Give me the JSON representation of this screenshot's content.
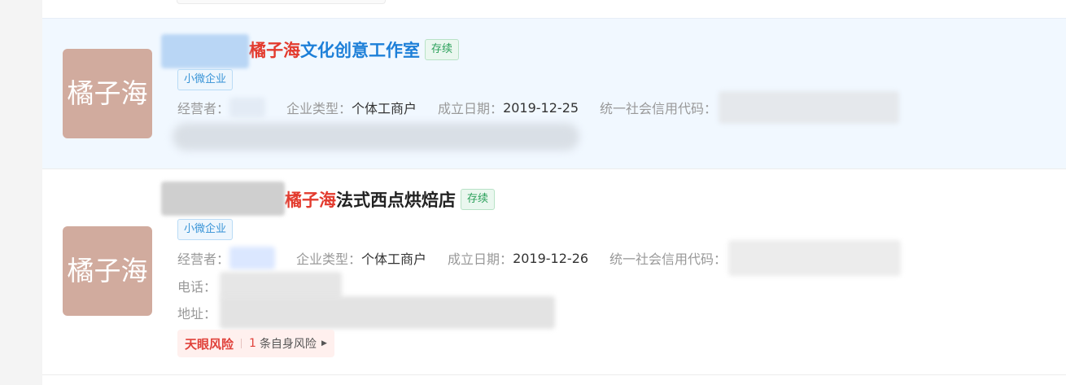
{
  "results": [
    {
      "logo_text": "橘子海",
      "title_highlight": "橘子海",
      "title_rest": "文化创意工作室",
      "status": "存续",
      "tag": "小微企业",
      "operator_label": "经营者：",
      "type_label": "企业类型：",
      "type_value": "个体工商户",
      "date_label": "成立日期：",
      "date_value": "2019-12-25",
      "credit_label": "统一社会信用代码："
    },
    {
      "logo_text": "橘子海",
      "title_highlight": "橘子海",
      "title_rest": "法式西点烘焙店",
      "status": "存续",
      "tag": "小微企业",
      "operator_label": "经营者：",
      "type_label": "企业类型：",
      "type_value": "个体工商户",
      "date_label": "成立日期：",
      "date_value": "2019-12-26",
      "credit_label": "统一社会信用代码：",
      "phone_label": "电话：",
      "address_label": "地址：",
      "risk": {
        "brand": "天眼风险",
        "count": "1",
        "text": "条自身风险",
        "arrow_icon": "triangle-right-icon"
      }
    }
  ],
  "colors": {
    "highlight": "#e33b2e",
    "title_link": "#1d7fd8",
    "logo_bg": "#d1ab9e",
    "status_green": "#2ba05a",
    "tag_blue": "#3592d6"
  }
}
